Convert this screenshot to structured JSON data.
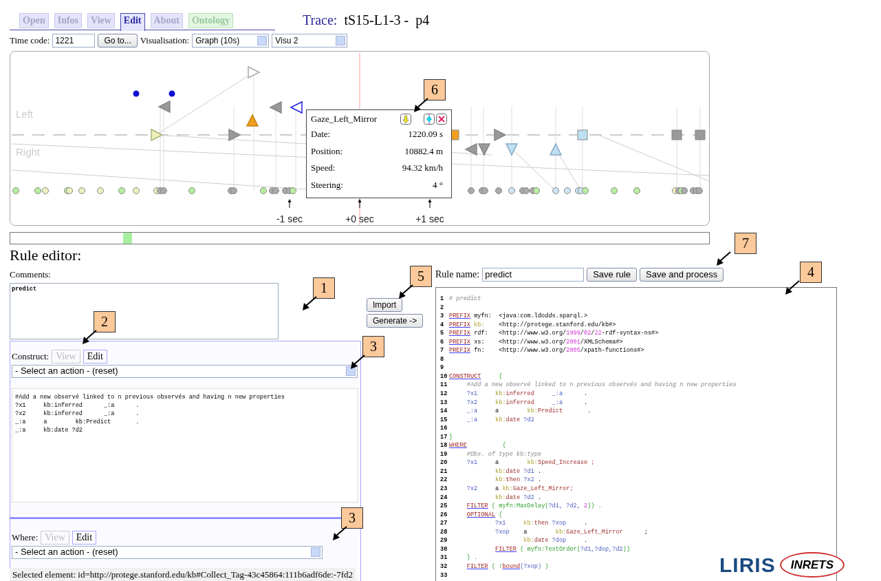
{
  "tabs": [
    {
      "label": "Open",
      "selected": false,
      "color": "#e4e4fb"
    },
    {
      "label": "Infos",
      "selected": false,
      "color": "#e4e4fb"
    },
    {
      "label": "View",
      "selected": false,
      "color": "#e4e4fb"
    },
    {
      "label": "Edit",
      "selected": true,
      "color": "#e4e4fb"
    },
    {
      "label": "About",
      "selected": false,
      "color": "#e4e4fb"
    },
    {
      "label": "Ontology",
      "selected": false,
      "color": "#e2f6e2"
    }
  ],
  "trace": {
    "label": "Trace:",
    "name": "tS15-L1-3 -",
    "part": "p4"
  },
  "toolbar": {
    "time_code_label": "Time code:",
    "time_code": "1221",
    "goto_button": "Go to...",
    "visualisation_label": "Visualisation:",
    "visualisation": "Graph (10s)",
    "visu": "Visu 2"
  },
  "graph": {
    "lanes": [
      "Left",
      "Right"
    ],
    "ticks": [
      "-1 sec",
      "+0 sec",
      "+1 sec"
    ],
    "tooltip": {
      "title": "Gaze_Left_Mirror",
      "rows": [
        {
          "label": "Date:",
          "value": "1220.09 s"
        },
        {
          "label": "Position:",
          "value": "10882.4 m"
        },
        {
          "label": "Speed:",
          "value": "94.32 km/h"
        },
        {
          "label": "Steering:",
          "value": "4 °"
        }
      ]
    }
  },
  "rule_editor": {
    "title": "Rule editor:",
    "comments_label": "Comments:",
    "comments": "predict",
    "sections": [
      {
        "label": "Construct:",
        "tabs": [
          {
            "label": "View",
            "selected": false
          },
          {
            "label": "Edit",
            "selected": true
          }
        ],
        "action": "- Select an action - (reset)",
        "code": [
          "#Add a new observé linked to n previous observés and having n new properties",
          "?x1     kb:inferred      _:a      .",
          "?x2     kb:inferred      _:a      .",
          "_:a     a        kb:Predict       .",
          "_:a     kb:date ?d2"
        ]
      },
      {
        "label": "Where:",
        "tabs": [
          {
            "label": "View",
            "selected": false
          },
          {
            "label": "Edit",
            "selected": true
          }
        ],
        "action": "- Select an action - (reset)"
      }
    ],
    "import_button": "Import",
    "generate_button": "Generate ->",
    "rule_name_label": "Rule name:",
    "rule_name": "predict",
    "save_button": "Save rule",
    "save_process_button": "Save and process",
    "lines": [
      {
        "num": "1",
        "tokens": [
          {
            "text": "# predict",
            "kind": "comment"
          }
        ]
      },
      {
        "num": "2"
      },
      {
        "num": "3",
        "tokens": [
          {
            "text": "PREFIX",
            "kind": "keyword"
          },
          {
            "text": " myfn:  <java:com.ldodds.sparql.>",
            "kind": "plain"
          }
        ]
      },
      {
        "num": "4",
        "tokens": [
          {
            "text": "PREFIX",
            "kind": "keyword"
          },
          {
            "text": " kb:",
            "kind": "prefix"
          },
          {
            "text": "    <http://protege.stanford.edu/kb#>",
            "kind": "plain"
          }
        ]
      },
      {
        "num": "5",
        "tokens": [
          {
            "text": "PREFIX",
            "kind": "keyword"
          },
          {
            "text": " rdf:   <http://www.w3.org/",
            "kind": "plain"
          },
          {
            "text": "1999",
            "kind": "num"
          },
          {
            "text": "/",
            "kind": "plain"
          },
          {
            "text": "02",
            "kind": "num"
          },
          {
            "text": "/",
            "kind": "plain"
          },
          {
            "text": "22",
            "kind": "num"
          },
          {
            "text": "-rdf-syntax-ns#>",
            "kind": "plain"
          }
        ]
      },
      {
        "num": "6",
        "tokens": [
          {
            "text": "PREFIX",
            "kind": "keyword"
          },
          {
            "text": " xs:    <http://www.w3.org/",
            "kind": "plain"
          },
          {
            "text": "2001",
            "kind": "num"
          },
          {
            "text": "/XMLSchema#>",
            "kind": "plain"
          }
        ]
      },
      {
        "num": "7",
        "tokens": [
          {
            "text": "PREFIX",
            "kind": "keyword"
          },
          {
            "text": " fn:    <http://www.w3.org/",
            "kind": "plain"
          },
          {
            "text": "2005",
            "kind": "num"
          },
          {
            "text": "/xpath-functions#>",
            "kind": "plain"
          }
        ]
      },
      {
        "num": "8"
      },
      {
        "num": "9"
      },
      {
        "num": "10",
        "tokens": [
          {
            "text": "CONSTRUCT",
            "kind": "keyword"
          },
          {
            "text": "     {",
            "kind": "punct"
          }
        ]
      },
      {
        "num": "11",
        "tokens": [
          {
            "text": "     #Add a new observé linked to n previous observés and having n new properties",
            "kind": "comment"
          }
        ]
      },
      {
        "num": "12",
        "tokens": [
          {
            "text": "     ?x1     ",
            "kind": "var"
          },
          {
            "text": "kb:",
            "kind": "prefix"
          },
          {
            "text": "inferred     ",
            "kind": "name"
          },
          {
            "text": "_:a",
            "kind": "var"
          },
          {
            "text": "      .",
            "kind": "plain"
          }
        ]
      },
      {
        "num": "13",
        "tokens": [
          {
            "text": "     ?x2     ",
            "kind": "var"
          },
          {
            "text": "kb:",
            "kind": "prefix"
          },
          {
            "text": "inferred     ",
            "kind": "name"
          },
          {
            "text": "_:a",
            "kind": "var"
          },
          {
            "text": "      .",
            "kind": "plain"
          }
        ]
      },
      {
        "num": "14",
        "tokens": [
          {
            "text": "     _:a     ",
            "kind": "var"
          },
          {
            "text": "a        ",
            "kind": "plain"
          },
          {
            "text": "kb:",
            "kind": "prefix"
          },
          {
            "text": "Predict",
            "kind": "name"
          },
          {
            "text": "       .",
            "kind": "plain"
          }
        ]
      },
      {
        "num": "15",
        "tokens": [
          {
            "text": "     _:a     ",
            "kind": "var"
          },
          {
            "text": "kb:",
            "kind": "prefix"
          },
          {
            "text": "date ",
            "kind": "name"
          },
          {
            "text": "?d2",
            "kind": "var"
          }
        ]
      },
      {
        "num": "16"
      },
      {
        "num": "17",
        "tokens": [
          {
            "text": "}",
            "kind": "punct"
          }
        ]
      },
      {
        "num": "18",
        "tokens": [
          {
            "text": "WHERE",
            "kind": "keyword"
          },
          {
            "text": "          {",
            "kind": "punct"
          }
        ]
      },
      {
        "num": "19",
        "tokens": [
          {
            "text": "     #Obs. of type kb:type",
            "kind": "comment"
          }
        ]
      },
      {
        "num": "20",
        "tokens": [
          {
            "text": "     ?x1     ",
            "kind": "var"
          },
          {
            "text": "a        ",
            "kind": "plain"
          },
          {
            "text": "kb:",
            "kind": "prefix"
          },
          {
            "text": "Speed_Increase ;",
            "kind": "name"
          }
        ]
      },
      {
        "num": "21",
        "tokens": [
          {
            "text": "             kb:",
            "kind": "prefix"
          },
          {
            "text": "date ",
            "kind": "name"
          },
          {
            "text": "?d1",
            "kind": "var"
          },
          {
            "text": " .",
            "kind": "plain"
          }
        ]
      },
      {
        "num": "22",
        "tokens": [
          {
            "text": "             kb:",
            "kind": "prefix"
          },
          {
            "text": "then ",
            "kind": "name"
          },
          {
            "text": "?x2",
            "kind": "var"
          },
          {
            "text": " .",
            "kind": "plain"
          }
        ]
      },
      {
        "num": "23",
        "tokens": [
          {
            "text": "     ?x2     ",
            "kind": "var"
          },
          {
            "text": "a ",
            "kind": "plain"
          },
          {
            "text": "kb:",
            "kind": "prefix"
          },
          {
            "text": "Gaze_Left_Mirror;",
            "kind": "name"
          }
        ]
      },
      {
        "num": "24",
        "tokens": [
          {
            "text": "             kb:",
            "kind": "prefix"
          },
          {
            "text": "date ",
            "kind": "name"
          },
          {
            "text": "?d2",
            "kind": "var"
          },
          {
            "text": " .",
            "kind": "plain"
          }
        ]
      },
      {
        "num": "25",
        "tokens": [
          {
            "text": "     FILTER",
            "kind": "keyword"
          },
          {
            "text": " ( ",
            "kind": "punct"
          },
          {
            "text": "myfn:MaxDelay(",
            "kind": "func"
          },
          {
            "text": "?d1, ?d2, ",
            "kind": "var"
          },
          {
            "text": "2",
            "kind": "num"
          },
          {
            "text": ")) .",
            "kind": "func"
          }
        ]
      },
      {
        "num": "26",
        "tokens": [
          {
            "text": "     OPTIONAL",
            "kind": "keyword"
          },
          {
            "text": " {",
            "kind": "punct"
          }
        ]
      },
      {
        "num": "27",
        "tokens": [
          {
            "text": "             ?x1     ",
            "kind": "var"
          },
          {
            "text": "kb:",
            "kind": "prefix"
          },
          {
            "text": "then ",
            "kind": "name"
          },
          {
            "text": "?xop",
            "kind": "var"
          },
          {
            "text": "     .",
            "kind": "plain"
          }
        ]
      },
      {
        "num": "28",
        "tokens": [
          {
            "text": "             ?xop    ",
            "kind": "var"
          },
          {
            "text": "a        ",
            "kind": "plain"
          },
          {
            "text": "kb:",
            "kind": "prefix"
          },
          {
            "text": "Gaze_Left_Mirror",
            "kind": "name"
          },
          {
            "text": "      ;",
            "kind": "plain"
          }
        ]
      },
      {
        "num": "29",
        "tokens": [
          {
            "text": "                     kb:",
            "kind": "prefix"
          },
          {
            "text": "date ",
            "kind": "name"
          },
          {
            "text": "?dop",
            "kind": "var"
          },
          {
            "text": "     .",
            "kind": "plain"
          }
        ]
      },
      {
        "num": "30",
        "tokens": [
          {
            "text": "             FILTER",
            "kind": "keyword"
          },
          {
            "text": " ( ",
            "kind": "punct"
          },
          {
            "text": "myfn:TestOrder(",
            "kind": "func"
          },
          {
            "text": "?d1,?dop,?d2",
            "kind": "var"
          },
          {
            "text": "))",
            "kind": "func"
          }
        ]
      },
      {
        "num": "31",
        "tokens": [
          {
            "text": "     } .",
            "kind": "punct"
          }
        ]
      },
      {
        "num": "32",
        "tokens": [
          {
            "text": "     FILTER",
            "kind": "keyword"
          },
          {
            "text": " ( !",
            "kind": "punct"
          },
          {
            "text": "bound",
            "kind": "keyword"
          },
          {
            "text": "(?xop)",
            "kind": "var"
          },
          {
            "text": " )",
            "kind": "punct"
          }
        ]
      },
      {
        "num": "33"
      }
    ]
  },
  "callouts": [
    {
      "text": "6"
    },
    {
      "text": "7"
    },
    {
      "text": "4"
    },
    {
      "text": "5"
    },
    {
      "text": "1"
    },
    {
      "text": "2"
    },
    {
      "text": "3"
    },
    {
      "text": "3"
    }
  ],
  "logo": {
    "left": "LIRIS",
    "right": "INRETS"
  },
  "status_bar": "Selected element: id=http://protege.stanford.edu/kb#Collect_Tag-43c45864:111b6adf6de:-7fd2"
}
